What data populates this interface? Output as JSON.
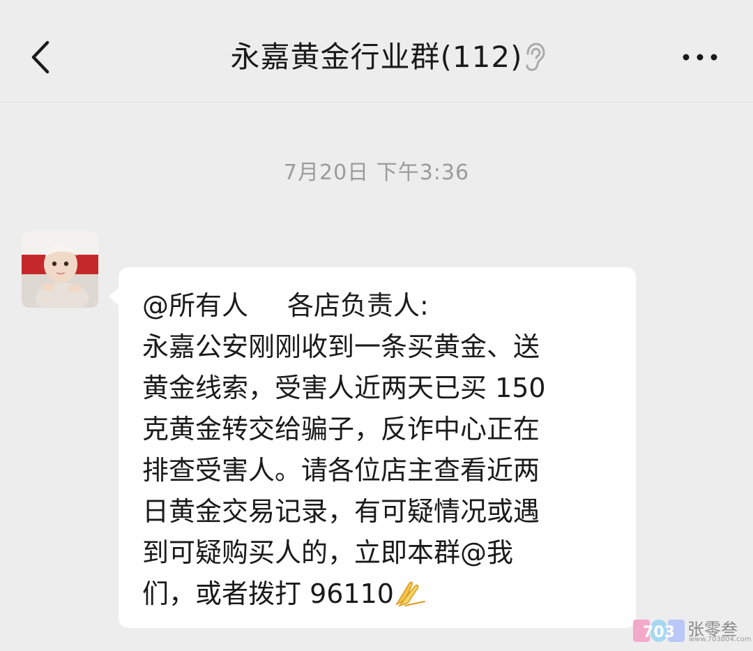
{
  "header": {
    "title": "永嘉黄金行业群(112)",
    "back_icon": "chevron-left-icon",
    "earpiece_icon": "ear-icon",
    "more_icon": "more-dots-icon"
  },
  "chat": {
    "timestamp": "7月20日 下午3:36",
    "message": {
      "mention": "@所有人",
      "greeting": "各店负责人:",
      "lines": [
        "永嘉公安刚刚收到一条买黄金、送",
        "黄金线索，受害人近两天已买 150",
        "克黄金转交给骗子，反诈中心正在",
        "排查受害人。请各位店主查看近两",
        "日黄金交易记录，有可疑情况或遇",
        "到可疑购买人的，立即本群@我",
        "们，或者拨打 96110"
      ],
      "emoji": "pray-hands-icon"
    }
  },
  "watermark": {
    "logo_text": "703",
    "name": "张零叁",
    "url": "www.703804.com"
  },
  "colors": {
    "background": "#ededed",
    "bubble": "#ffffff",
    "text": "#1a1a1a",
    "timestamp": "#9b9b9b"
  }
}
